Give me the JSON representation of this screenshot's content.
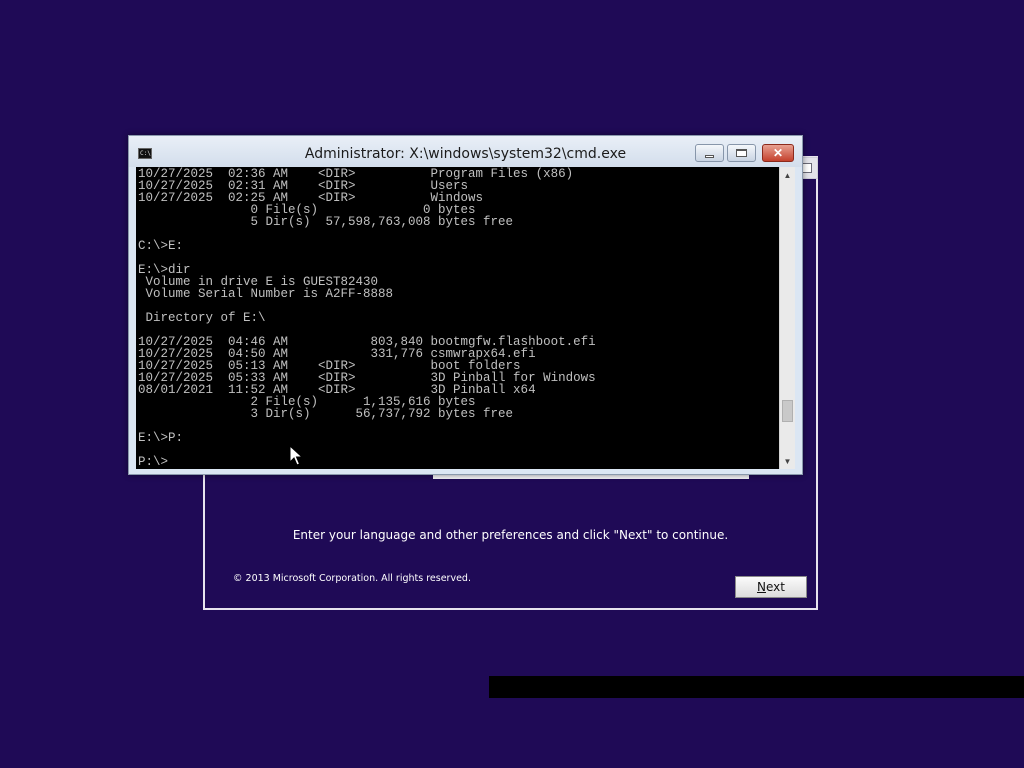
{
  "setup": {
    "instructions": "Enter your language and other preferences and click \"Next\" to continue.",
    "copyright": "© 2013 Microsoft Corporation. All rights reserved.",
    "next_label_underlined": "N",
    "next_label_rest": "ext"
  },
  "cmd": {
    "icon_text": "C:\\",
    "title": "Administrator: X:\\windows\\system32\\cmd.exe",
    "lines": [
      "10/27/2025  02:36 AM    <DIR>          Program Files (x86)",
      "10/27/2025  02:31 AM    <DIR>          Users",
      "10/27/2025  02:25 AM    <DIR>          Windows",
      "               0 File(s)              0 bytes",
      "               5 Dir(s)  57,598,763,008 bytes free",
      "",
      "C:\\>E:",
      "",
      "E:\\>dir",
      " Volume in drive E is GUEST82430",
      " Volume Serial Number is A2FF-8888",
      "",
      " Directory of E:\\",
      "",
      "10/27/2025  04:46 AM           803,840 bootmgfw.flashboot.efi",
      "10/27/2025  04:50 AM           331,776 csmwrapx64.efi",
      "10/27/2025  05:13 AM    <DIR>          boot folders",
      "10/27/2025  05:33 AM    <DIR>          3D Pinball for Windows",
      "08/01/2021  11:52 AM    <DIR>          3D Pinball x64",
      "               2 File(s)      1,135,616 bytes",
      "               3 Dir(s)      56,737,792 bytes free",
      "",
      "E:\\>P:",
      "",
      "P:\\>"
    ]
  },
  "colors": {
    "desktop_bg": "#1f0a56",
    "console_bg": "#000000",
    "console_fg": "#c0c0c0",
    "close_button": "#c4412d"
  }
}
